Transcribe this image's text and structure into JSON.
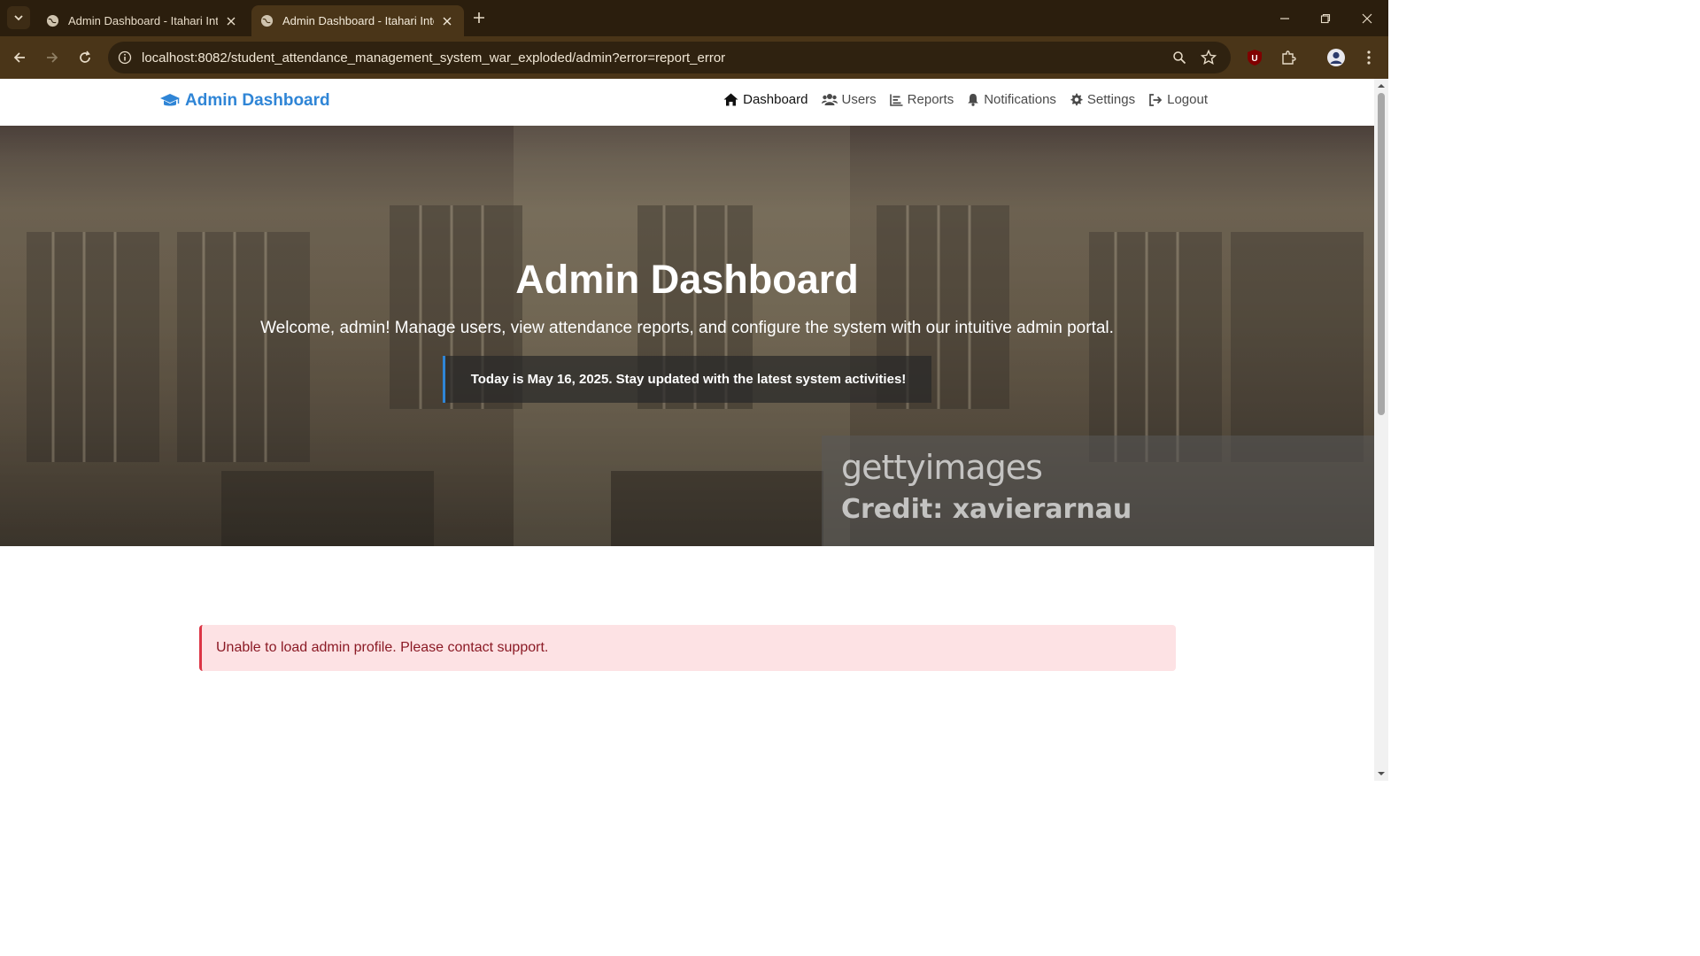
{
  "browser": {
    "tabs": [
      {
        "title": "Admin Dashboard - Itahari Inte",
        "active": false
      },
      {
        "title": "Admin Dashboard - Itahari Inte",
        "active": true
      }
    ],
    "url": "localhost:8082/student_attendance_management_system_war_exploded/admin?error=report_error",
    "extension_badge": "U"
  },
  "navbar": {
    "brand": "Admin Dashboard",
    "links": [
      {
        "label": "Dashboard",
        "icon": "home-icon",
        "active": true
      },
      {
        "label": "Users",
        "icon": "users-icon",
        "active": false
      },
      {
        "label": "Reports",
        "icon": "reports-icon",
        "active": false
      },
      {
        "label": "Notifications",
        "icon": "bell-icon",
        "active": false
      },
      {
        "label": "Settings",
        "icon": "gear-icon",
        "active": false
      },
      {
        "label": "Logout",
        "icon": "logout-icon",
        "active": false
      }
    ]
  },
  "hero": {
    "title": "Admin Dashboard",
    "subtitle": "Welcome, admin! Manage users, view attendance reports, and configure the system with our intuitive admin portal.",
    "note": "Today is May 16, 2025. Stay updated with the latest system activities!",
    "watermark_logo": "gettyimages",
    "watermark_credit": "Credit: xavierarnau"
  },
  "alert": {
    "message": "Unable to load admin profile. Please contact support."
  },
  "colors": {
    "brand": "#2f85d6",
    "alert_bg": "#fde2e4",
    "alert_border": "#dc3545",
    "browser_chrome": "#4a3518"
  }
}
